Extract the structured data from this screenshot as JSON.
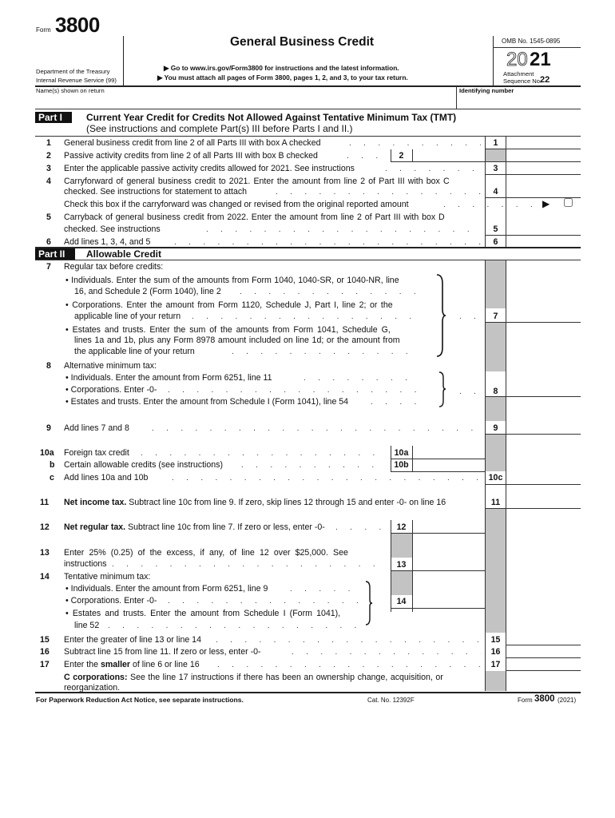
{
  "header": {
    "form_prefix": "Form",
    "form_number": "3800",
    "department": "Department of the Treasury",
    "irs": "Internal Revenue Service (99)",
    "title": "General Business Credit",
    "instruction1": "▶ Go to www.irs.gov/Form3800 for instructions and the latest information.",
    "instruction2": "▶ You must attach all pages of Form 3800, pages 1, 2, and 3, to your tax return.",
    "omb": "OMB No. 1545-0895",
    "year_outline": "20",
    "year_bold": "21",
    "attachment": "Attachment",
    "sequence_label": "Sequence No.",
    "sequence_no": "22",
    "name_label": "Name(s) shown on return",
    "id_label": "Identifying number"
  },
  "part1": {
    "badge": "Part I",
    "title": "Current Year Credit for Credits Not Allowed Against Tentative Minimum Tax (TMT)",
    "subtitle": "(See instructions and complete Part(s) III before Parts I and II.)",
    "lines": {
      "l1": {
        "num": "1",
        "text": "General business credit from line 2 of all Parts III with box A checked",
        "box": "1"
      },
      "l2": {
        "num": "2",
        "text": "Passive activity credits from line 2 of all Parts III with box B checked",
        "box": "2"
      },
      "l3": {
        "num": "3",
        "text": "Enter the applicable passive activity credits allowed for 2021. See instructions",
        "box": "3"
      },
      "l4": {
        "num": "4",
        "text1": "Carryforward of general business credit to 2021. Enter the amount from line 2 of Part III with box C",
        "text2": "checked. See instructions for statement to attach",
        "box": "4"
      },
      "check": {
        "text": "Check this box if the carryforward was changed or revised from the original reported amount",
        "arrow": "▶",
        "checked": false
      },
      "l5": {
        "num": "5",
        "text1": "Carryback of general business credit from 2022. Enter the amount from line 2 of Part III with box D",
        "text2": "checked. See instructions",
        "box": "5"
      },
      "l6": {
        "num": "6",
        "text": "Add lines 1, 3, 4, and 5",
        "box": "6"
      }
    }
  },
  "part2": {
    "badge": "Part II",
    "title": "Allowable Credit",
    "lines": {
      "l7": {
        "num": "7",
        "text": "Regular tax before credits:",
        "b1a": "• Individuals. Enter the sum of the amounts from Form 1040, 1040-SR, or 1040-NR, line",
        "b1b": "16, and Schedule 2 (Form 1040), line 2",
        "b2a": "• Corporations. Enter the amount from Form 1120, Schedule J, Part I, line 2; or the",
        "b2b": "applicable line of your return",
        "b3a": "• Estates and trusts. Enter the sum of the amounts from Form 1041, Schedule G,",
        "b3b": "lines 1a and 1b, plus any Form 8978 amount included on line 1d; or the amount from",
        "b3c": "the applicable line of your return",
        "box": "7"
      },
      "l8": {
        "num": "8",
        "text": "Alternative minimum tax:",
        "b1": "• Individuals. Enter the amount from Form 6251, line 11",
        "b2": "• Corporations. Enter -0-",
        "b3": "• Estates and trusts. Enter the amount from Schedule I (Form 1041), line 54",
        "box": "8"
      },
      "l9": {
        "num": "9",
        "text": "Add lines 7 and 8",
        "box": "9"
      },
      "l10a": {
        "num": "10a",
        "text": "Foreign tax credit",
        "box": "10a"
      },
      "l10b": {
        "num": "b",
        "text": "Certain allowable credits (see instructions)",
        "box": "10b"
      },
      "l10c": {
        "num": "c",
        "text": "Add lines 10a and 10b",
        "box": "10c"
      },
      "l11": {
        "num": "11",
        "bold": "Net income tax.",
        "text": " Subtract line 10c from line 9. If zero, skip lines 12 through 15 and enter -0- on line 16",
        "box": "11"
      },
      "l12": {
        "num": "12",
        "bold": "Net regular tax.",
        "text": " Subtract line 10c from line 7. If zero or less, enter -0-",
        "box": "12"
      },
      "l13": {
        "num": "13",
        "text1": "Enter 25% (0.25) of the excess, if any, of line 12 over $25,000. See",
        "text2": "instructions",
        "box": "13"
      },
      "l14": {
        "num": "14",
        "text": "Tentative minimum tax:",
        "b1": "• Individuals. Enter the amount from Form 6251, line 9",
        "b2": "• Corporations. Enter -0-",
        "b3a": "• Estates and trusts. Enter the amount from Schedule I (Form 1041),",
        "b3b": "line 52",
        "box": "14"
      },
      "l15": {
        "num": "15",
        "text": "Enter the greater of line 13 or line 14",
        "box": "15"
      },
      "l16": {
        "num": "16",
        "text": "Subtract line 15 from line 11. If zero or less, enter -0-",
        "box": "16"
      },
      "l17": {
        "num": "17",
        "pre": "Enter the ",
        "bold": "smaller",
        "post": " of line 6 or line 16",
        "box": "17"
      },
      "ccorp": {
        "bold": "C corporations:",
        "text": " See the line 17 instructions if there has been an ownership change, acquisition, or",
        "text2": "reorganization."
      }
    }
  },
  "footer": {
    "paperwork": "For Paperwork Reduction Act Notice, see separate instructions.",
    "cat": "Cat. No. 12392F",
    "form_prefix": "Form",
    "form_number": "3800",
    "year": "(2021)"
  }
}
